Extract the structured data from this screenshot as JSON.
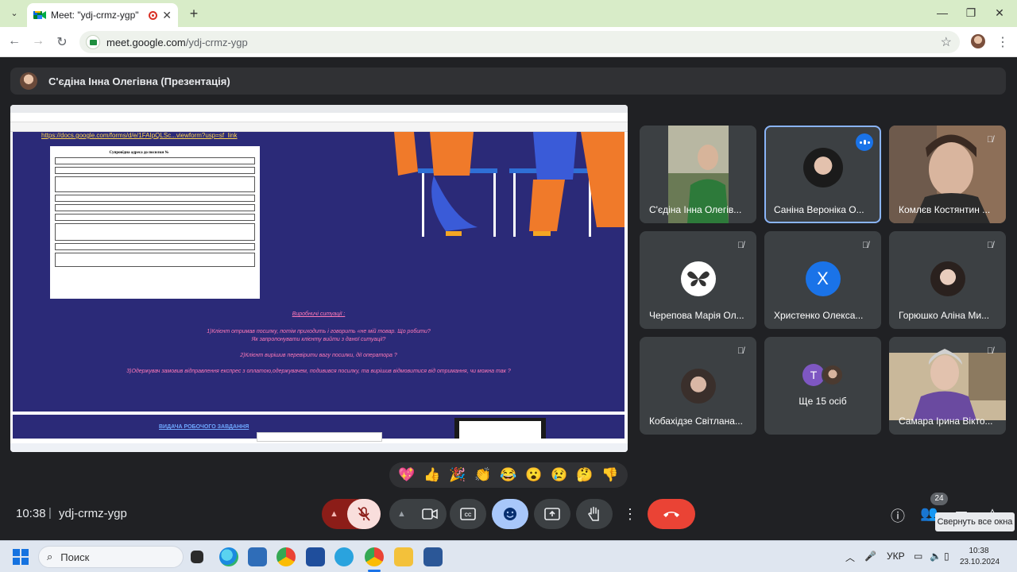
{
  "browser": {
    "tab_title": "Meet: \"ydj-crmz-ygp\"",
    "url_host": "meet.google.com",
    "url_path": "/ydj-crmz-ygp",
    "new_tab_label": "+",
    "tab_close": "✕"
  },
  "presenter": {
    "label": "С'єдіна Інна Олегівна (Презентація)"
  },
  "shared_screen": {
    "situations_heading": "Виробничі ситуації :",
    "situation_1": "1)Клієнт отримав посилку, потім приходить і говорить «не мій товар. Що робити?",
    "situation_1b": "Як запропонувати клієнту вийти з даної ситуації?",
    "situation_2": "2)Клієнт вирішив перевірити вагу посилки, дії оператора ?",
    "situation_3": "3)Одержувач замовив відправлення експрес з оплатою,одержувачем, подивився посилку, та вирішив відмовитися від отримання, чи можна так ?",
    "task_heading": "ВИДАЧА РОБОЧОГО ЗАВДАННЯ",
    "form_title": "Супровідна адреса до посилки №"
  },
  "participants": [
    {
      "name": "С'єдіна Інна Олегів...",
      "muted": false,
      "kind": "video"
    },
    {
      "name": "Саніна Вероніка О...",
      "muted": false,
      "kind": "avatar",
      "speaking": true
    },
    {
      "name": "Комлєв Костянтин ...",
      "muted": true,
      "kind": "video"
    },
    {
      "name": "Черепова Марія Ол...",
      "muted": true,
      "kind": "avatar"
    },
    {
      "name": "Христенко Олекса...",
      "muted": true,
      "kind": "letter",
      "letter": "X"
    },
    {
      "name": "Горюшко Аліна Ми...",
      "muted": true,
      "kind": "avatar"
    },
    {
      "name": "Кобахідзе Світлана...",
      "muted": true,
      "kind": "avatar"
    },
    {
      "name": "Ще 15 осіб",
      "muted": false,
      "kind": "more",
      "letter": "T"
    },
    {
      "name": "Самара Ірина Вікто...",
      "muted": true,
      "kind": "video"
    }
  ],
  "reactions": [
    "💖",
    "👍",
    "🎉",
    "👏",
    "😂",
    "😮",
    "😢",
    "🤔",
    "👎"
  ],
  "meeting": {
    "time": "10:38",
    "separator": "|",
    "code": "ydj-crmz-ygp",
    "people_count": "24",
    "tooltip": "Свернуть все окна"
  },
  "taskbar": {
    "search_placeholder": "Поиск",
    "lang": "УКР",
    "time": "10:38",
    "date": "23.10.2024"
  },
  "colors": {
    "meet_bg": "#202124",
    "tile_bg": "#3c4043",
    "end_call": "#ea4335",
    "accent_blue": "#8ab4f8",
    "mic_off": "#f9dedc"
  }
}
